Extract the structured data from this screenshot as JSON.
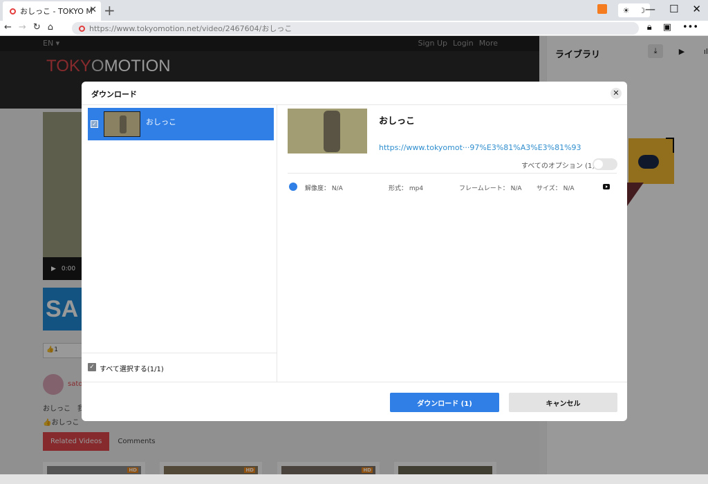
{
  "browser": {
    "tab_title": "おしっこ - TOKYO M",
    "tab_close": "✕",
    "new_tab": "+",
    "url": "https://www.tokyomotion.net/video/2467604/おしっこ",
    "nav": {
      "back": "←",
      "forward": "→",
      "reload": "↻",
      "home": "⌂"
    },
    "theme_light": "☀",
    "theme_dark": "☽",
    "win_min": "—",
    "win_max": "☐",
    "win_close": "✕",
    "more": "•••"
  },
  "site": {
    "lang": "EN ▾",
    "links": [
      "Sign Up",
      "Login",
      "More"
    ],
    "logo_left": "TOKY",
    "logo_mid": "O",
    "logo_right": "MOTION",
    "time": "0:00",
    "ad_text": "SA",
    "likes": "👍1",
    "user": "satoi",
    "desc1": "おしっこ　我",
    "desc2": "👍おしっこ",
    "tab_related": "Related Videos",
    "tab_comments": "Comments",
    "hd": "HD"
  },
  "library": {
    "title": "ライブラリ",
    "icons": [
      "download-icon",
      "youtube-icon",
      "audio-icon"
    ]
  },
  "modal": {
    "title": "ダウンロード",
    "close": "✕",
    "item_label": "おしっこ",
    "select_all": "すべて選択する(1/1)",
    "detail_title": "おしっこ",
    "detail_url": "https://www.tokyomot···97%E3%81%A3%E3%81%93",
    "options_label": "すべてのオプション (1)",
    "resolution": "解像度： N/A",
    "format": "形式： mp4",
    "framerate": "フレームレート： N/A",
    "size": "サイズ： N/A",
    "download_button": "ダウンロード (1)",
    "cancel_button": "キャンセル"
  }
}
